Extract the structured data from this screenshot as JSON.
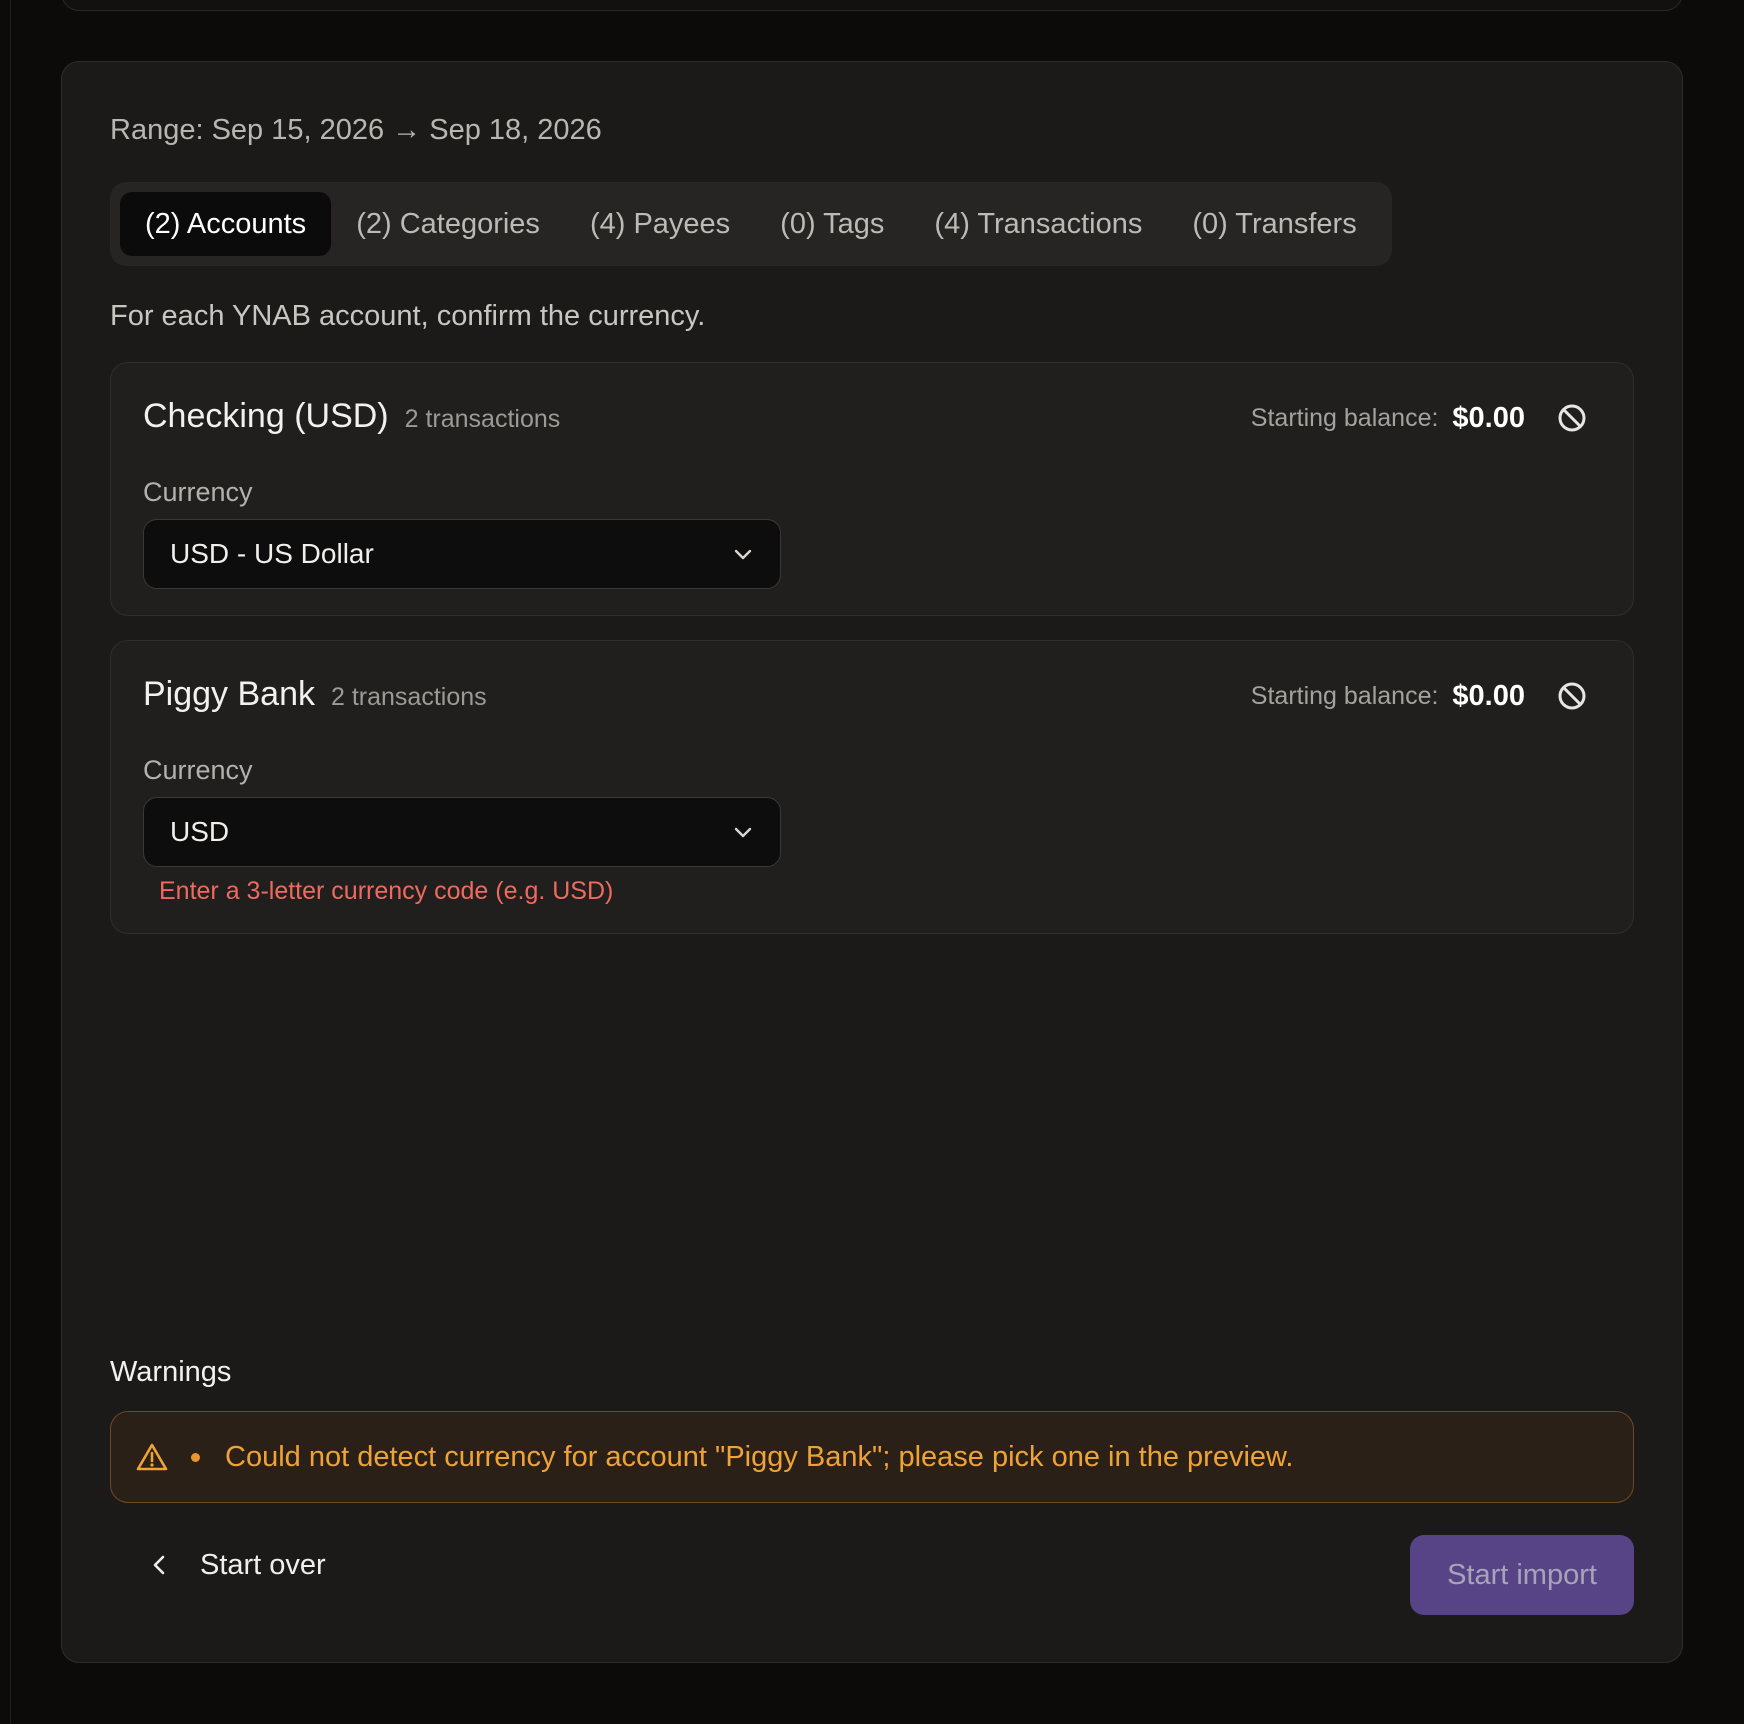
{
  "range": {
    "text": "Range: Sep 15, 2026 → Sep 18, 2026"
  },
  "tabs": [
    {
      "label": "(2) Accounts",
      "active": true
    },
    {
      "label": "(2) Categories",
      "active": false
    },
    {
      "label": "(4) Payees",
      "active": false
    },
    {
      "label": "(0) Tags",
      "active": false
    },
    {
      "label": "(4) Transactions",
      "active": false
    },
    {
      "label": "(0) Transfers",
      "active": false
    }
  ],
  "hint": "For each YNAB account, confirm the currency.",
  "accounts": [
    {
      "name": "Checking (USD)",
      "count": "2 transactions",
      "balance_label": "Starting balance:",
      "balance": "$0.00",
      "currency_label": "Currency",
      "currency_value": "USD - US Dollar",
      "error": ""
    },
    {
      "name": "Piggy Bank",
      "count": "2 transactions",
      "balance_label": "Starting balance:",
      "balance": "$0.00",
      "currency_label": "Currency",
      "currency_value": "USD",
      "error": "Enter a 3-letter currency code (e.g. USD)"
    }
  ],
  "warnings": {
    "title": "Warnings",
    "items": [
      "Could not detect currency for account \"Piggy Bank\"; please pick one in the preview."
    ]
  },
  "footer": {
    "back_label": "Start over",
    "primary_label": "Start import"
  },
  "colors": {
    "accent": "#574486",
    "warning": "#efa235",
    "error": "#ef6a5e"
  }
}
